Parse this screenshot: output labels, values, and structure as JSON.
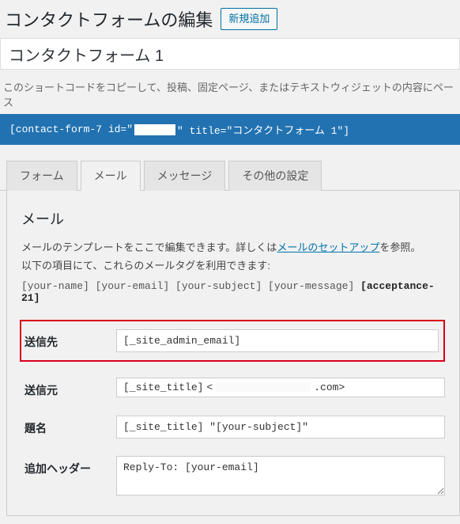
{
  "header": {
    "title": "コンタクトフォームの編集",
    "add_new": "新規追加"
  },
  "form_title": "コンタクトフォーム 1",
  "shortcode": {
    "desc": "このショートコードをコピーして、投稿、固定ページ、またはテキストウィジェットの内容にペース",
    "prefix": "[contact-form-7 id=\"",
    "suffix": "\" title=\"コンタクトフォーム 1\"]"
  },
  "tabs": {
    "form": "フォーム",
    "mail": "メール",
    "messages": "メッセージ",
    "other": "その他の設定"
  },
  "mail": {
    "heading": "メール",
    "desc_prefix": "メールのテンプレートをここで編集できます。詳しくは",
    "desc_link": "メールのセットアップ",
    "desc_suffix": "を参照。",
    "desc_line2": "以下の項目にて、これらのメールタグを利用できます:",
    "tags_plain": "[your-name] [your-email] [your-subject] [your-message] ",
    "tags_bold": "[acceptance-21]",
    "fields": {
      "to_label": "送信先",
      "to_value": "[_site_admin_email]",
      "from_label": "送信元",
      "from_prefix": "[_site_title] ",
      "from_sep": "<",
      "from_suffix": ".com>",
      "subject_label": "題名",
      "subject_value": "[_site_title] \"[your-subject]\"",
      "headers_label": "追加ヘッダー",
      "headers_value": "Reply-To: [your-email]"
    }
  }
}
